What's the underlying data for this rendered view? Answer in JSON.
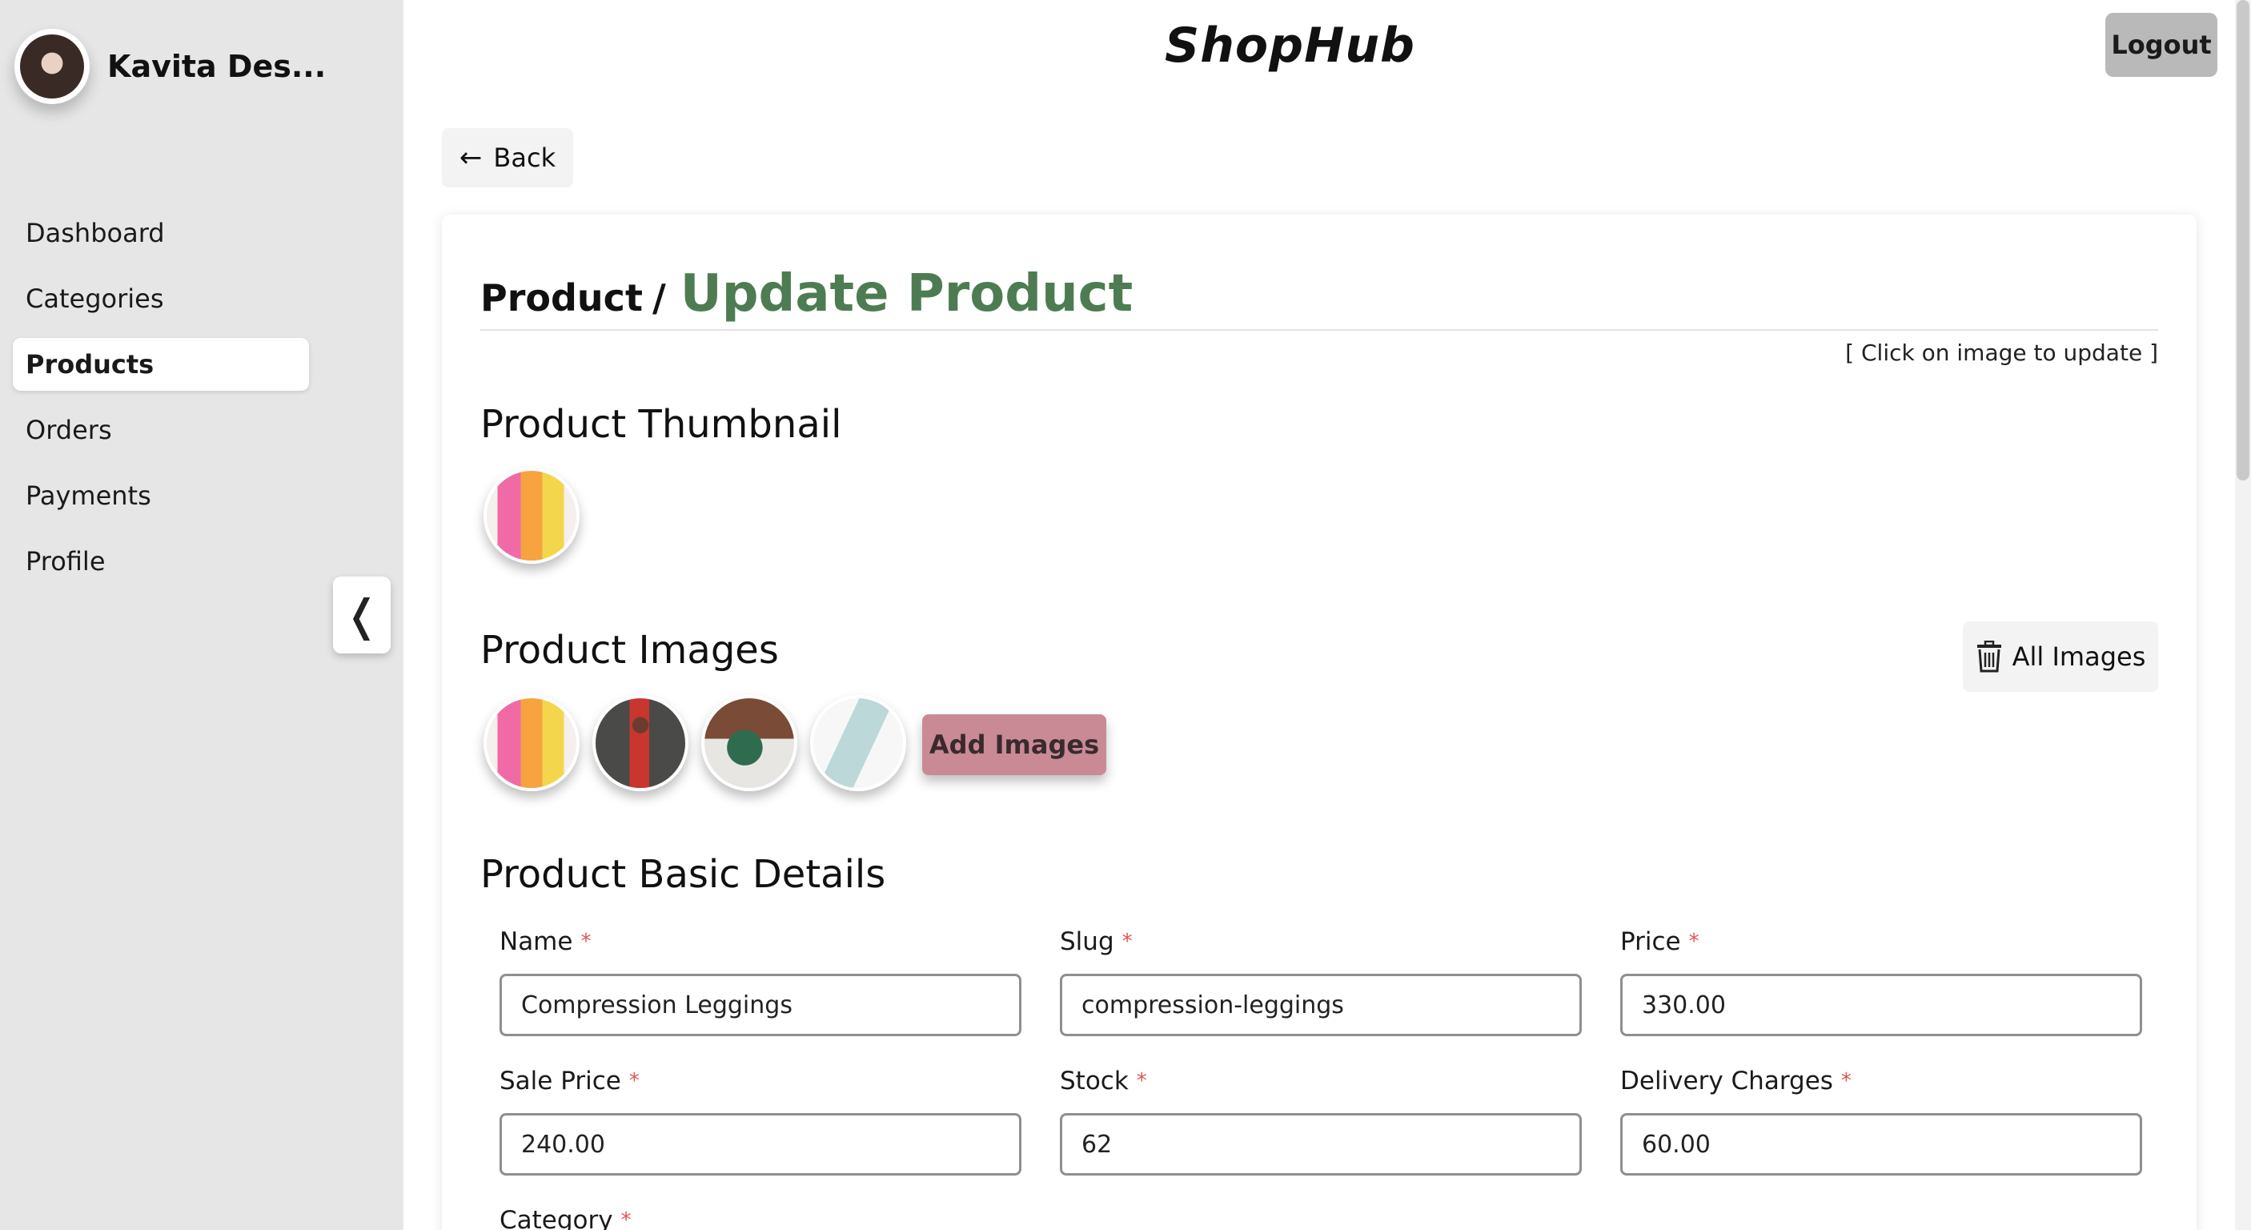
{
  "sidebar": {
    "username": "Kavita Des...",
    "items": [
      {
        "label": "Dashboard",
        "active": false
      },
      {
        "label": "Categories",
        "active": false
      },
      {
        "label": "Products",
        "active": true
      },
      {
        "label": "Orders",
        "active": false
      },
      {
        "label": "Payments",
        "active": false
      },
      {
        "label": "Profile",
        "active": false
      }
    ],
    "collapse_glyph": "❬"
  },
  "header": {
    "brand": "ShopHub",
    "logout_label": "Logout"
  },
  "back_label": "Back",
  "page": {
    "breadcrumb_root": "Product",
    "breadcrumb_sep": "/",
    "title": "Update Product",
    "title_color": "#4e7c52",
    "hint": "[ Click on image to update ]"
  },
  "thumbnail_section": {
    "title": "Product Thumbnail",
    "image": "leggings-multicolor"
  },
  "images_section": {
    "title": "Product Images",
    "delete_all_label": "All Images",
    "images": [
      "leggings-multicolor",
      "gym-woman",
      "yoga-woman",
      "leggings-lightblue"
    ],
    "add_label": "Add Images",
    "add_color": "#c98a96"
  },
  "basic_details": {
    "title": "Product Basic Details",
    "required_mark": "*",
    "fields": [
      {
        "label": "Name",
        "value": "Compression Leggings"
      },
      {
        "label": "Slug",
        "value": "compression-leggings"
      },
      {
        "label": "Price",
        "value": "330.00"
      },
      {
        "label": "Sale Price",
        "value": "240.00"
      },
      {
        "label": "Stock",
        "value": "62"
      },
      {
        "label": "Delivery Charges",
        "value": "60.00"
      },
      {
        "label": "Category",
        "value": ""
      }
    ]
  }
}
